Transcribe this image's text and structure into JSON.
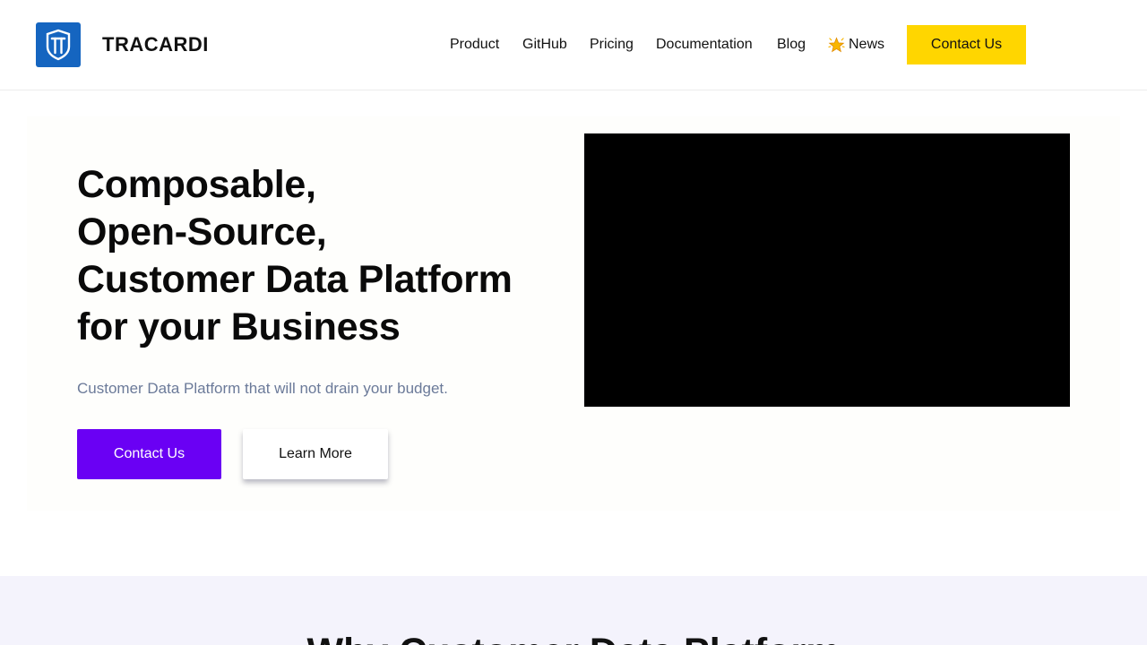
{
  "brand": {
    "name": "TRACARDI",
    "logo_icon": "tracardi-shield-logo",
    "logo_color": "#1565c0"
  },
  "nav": {
    "items": [
      {
        "label": "Product"
      },
      {
        "label": "GitHub"
      },
      {
        "label": "Pricing"
      },
      {
        "label": "Documentation"
      },
      {
        "label": "Blog"
      },
      {
        "label": "News",
        "icon": "star-icon"
      }
    ],
    "contact_label": "Contact Us",
    "contact_color": "#ffd600"
  },
  "hero": {
    "headline": [
      "Composable,",
      "Open-Source,",
      "Customer Data Platform",
      "for your Business"
    ],
    "subtitle": "Customer Data Platform that will not drain your budget.",
    "primary_button": "Contact Us",
    "secondary_button": "Learn More",
    "primary_color": "#6a00f4"
  },
  "why_section": {
    "title": "Why Customer Data Platform"
  }
}
